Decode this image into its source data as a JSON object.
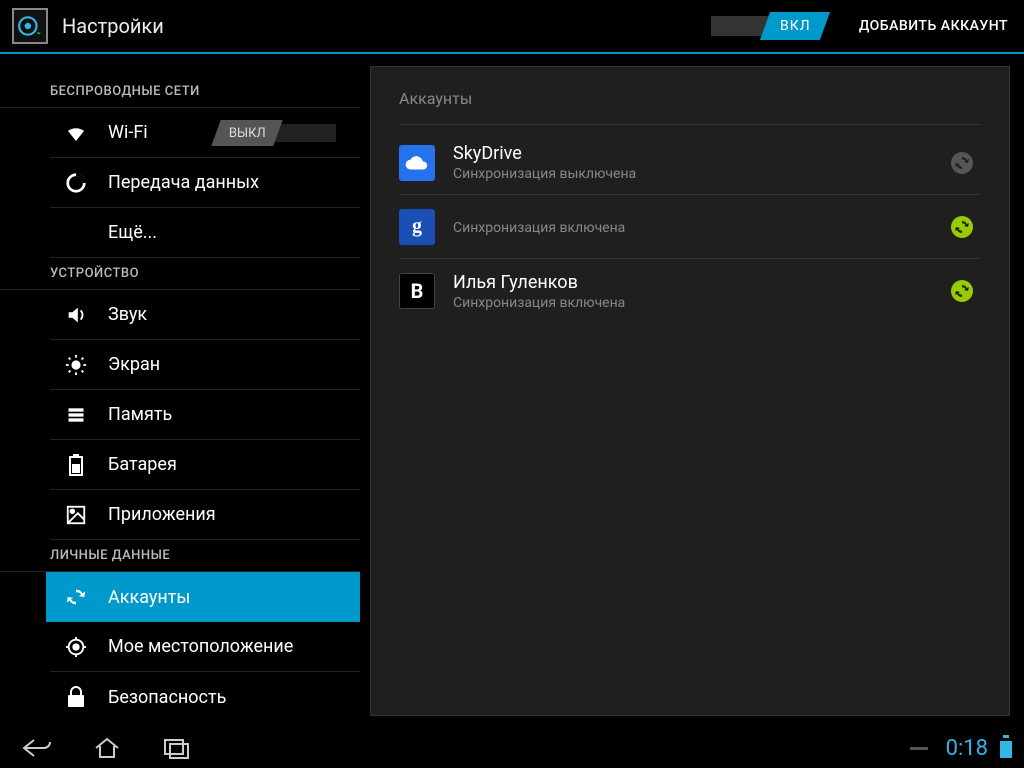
{
  "header": {
    "title": "Настройки",
    "master_toggle_label": "ВКЛ",
    "add_account_label": "ДОБАВИТЬ АККАУНТ"
  },
  "sidebar": {
    "section_wireless": "БЕСПРОВОДНЫЕ СЕТИ",
    "item_wifi": "Wi-Fi",
    "wifi_toggle_label": "ВЫКЛ",
    "item_data": "Передача данных",
    "item_more": "Ещё...",
    "section_device": "УСТРОЙСТВО",
    "item_sound": "Звук",
    "item_display": "Экран",
    "item_storage": "Память",
    "item_battery": "Батарея",
    "item_apps": "Приложения",
    "section_personal": "ЛИЧНЫЕ ДАННЫЕ",
    "item_accounts": "Аккаунты",
    "item_location": "Мое местоположение",
    "item_security": "Безопасность"
  },
  "detail": {
    "header": "Аккаунты",
    "accounts": [
      {
        "name": "SkyDrive",
        "sub": "Синхронизация выключена"
      },
      {
        "name": "",
        "sub": "Синхронизация включена"
      },
      {
        "name": "Илья Гуленков",
        "sub": "Синхронизация включена"
      }
    ]
  },
  "status": {
    "clock": "0:18"
  },
  "colors": {
    "accent": "#0099cc",
    "holo_blue": "#33b5e5",
    "sync_on": "#99cc00"
  }
}
